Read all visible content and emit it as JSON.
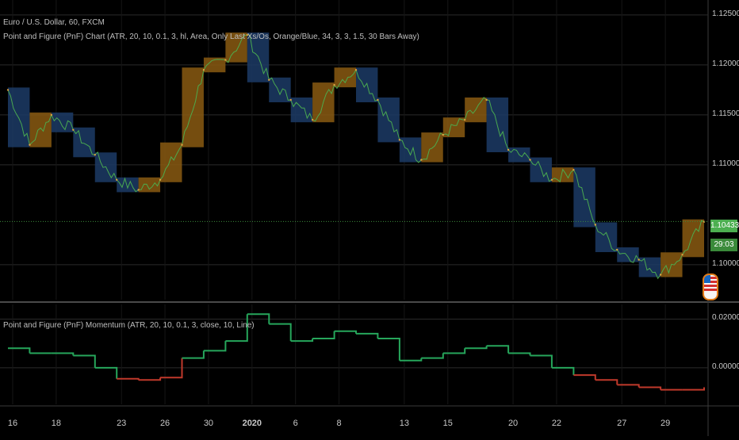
{
  "chart": {
    "symbol_title": "Euro / U.S. Dollar, 60, FXCM",
    "main_indicator": "Point and Figure (PnF) Chart (ATR, 20, 10, 0.1, 3, hl, Area, Only Last Xs/Os, Orange/Blue, 34, 3, 3, 1.5, 30 Bars Away)",
    "osc_indicator": "Point and Figure (PnF) Momentum (ATR, 20, 10, 0.1, 3, close, 10, Line)",
    "current_price": "1.10433",
    "countdown": "29:03",
    "price_ticks": [
      "1.12500",
      "1.12000",
      "1.11500",
      "1.11000",
      "1.10000"
    ],
    "osc_ticks": [
      "0.02000",
      "0.00000"
    ],
    "date_ticks": [
      "16",
      "18",
      "23",
      "26",
      "30",
      "2020",
      "6",
      "8",
      "13",
      "15",
      "20",
      "22",
      "27",
      "29"
    ],
    "colors": {
      "background": "#000000",
      "grid": "#2a2a2a",
      "price_line": "#4caf50",
      "box_orange": "#8a5a12",
      "box_blue": "#1c3b66",
      "momentum_up": "#26a65b",
      "momentum_down": "#c0392b",
      "badge": "#4caf50",
      "current_price_line": "#3d8a3d"
    }
  },
  "chart_data": [
    {
      "type": "line",
      "title": "",
      "xlabel": "",
      "ylabel": "",
      "x": [
        "16",
        "17",
        "18",
        "19",
        "20",
        "23",
        "24",
        "26",
        "27",
        "30",
        "31",
        "2020",
        "3",
        "6",
        "7",
        "8",
        "9",
        "10",
        "13",
        "14",
        "15",
        "16",
        "17",
        "20",
        "21",
        "22",
        "23",
        "24",
        "27",
        "28",
        "29",
        "30",
        "31"
      ],
      "series": [
        {
          "values": [
            1.1175,
            1.112,
            1.115,
            1.1135,
            1.111,
            1.1085,
            1.1075,
            1.1085,
            1.112,
            1.1195,
            1.1205,
            1.123,
            1.1185,
            1.1165,
            1.1145,
            1.118,
            1.1195,
            1.1165,
            1.1125,
            1.1105,
            1.113,
            1.1145,
            1.1165,
            1.1115,
            1.1105,
            1.1085,
            1.1095,
            1.104,
            1.1015,
            1.1005,
            1.099,
            1.101,
            1.1043
          ]
        }
      ],
      "ylim": [
        1.0965,
        1.1265
      ],
      "grid": true,
      "current_value": 1.10433
    },
    {
      "type": "line",
      "title": "",
      "xlabel": "",
      "ylabel": "",
      "x": [
        "16",
        "17",
        "18",
        "19",
        "20",
        "23",
        "24",
        "26",
        "27",
        "30",
        "31",
        "2020",
        "3",
        "6",
        "7",
        "8",
        "9",
        "10",
        "13",
        "14",
        "15",
        "16",
        "17",
        "20",
        "21",
        "22",
        "23",
        "24",
        "27",
        "28",
        "29",
        "30",
        "31"
      ],
      "series": [
        {
          "values": [
            0.008,
            0.006,
            0.006,
            0.005,
            0.0,
            -0.0045,
            -0.005,
            -0.004,
            0.004,
            0.007,
            0.011,
            0.022,
            0.018,
            0.011,
            0.012,
            0.015,
            0.014,
            0.012,
            0.003,
            0.004,
            0.006,
            0.008,
            0.009,
            0.006,
            0.005,
            0.0,
            -0.003,
            -0.005,
            -0.007,
            -0.008,
            -0.009,
            -0.009,
            -0.008
          ]
        }
      ],
      "ylim": [
        -0.015,
        0.026
      ],
      "grid": true
    }
  ]
}
